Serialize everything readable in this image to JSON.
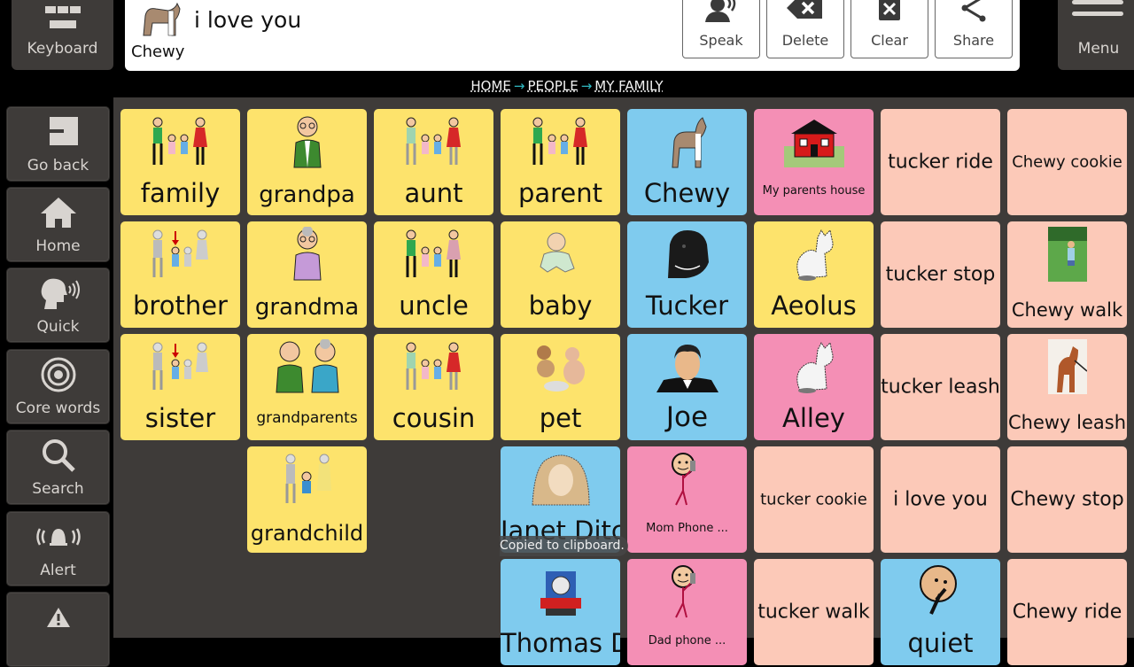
{
  "topbar": {
    "keyboard_label": "Keyboard",
    "menu_label": "Menu",
    "message": {
      "symbol_label": "Chewy",
      "text": "i love you"
    },
    "actions": [
      {
        "label": "Speak",
        "icon": "speak-icon"
      },
      {
        "label": "Delete",
        "icon": "backspace-icon"
      },
      {
        "label": "Clear",
        "icon": "clear-icon"
      },
      {
        "label": "Share",
        "icon": "share-icon"
      }
    ]
  },
  "breadcrumb": [
    "HOME",
    "PEOPLE",
    "MY FAMILY"
  ],
  "sidebar": {
    "items": [
      {
        "label": "Go back",
        "icon": "go-back-icon"
      },
      {
        "label": "Home",
        "icon": "home-icon"
      },
      {
        "label": "Quick",
        "icon": "quick-speak-icon"
      },
      {
        "label": "Core words",
        "icon": "core-words-icon"
      },
      {
        "label": "Search",
        "icon": "search-icon"
      },
      {
        "label": "Alert",
        "icon": "alert-bell-icon"
      },
      {
        "label": "",
        "icon": "warning-icon"
      }
    ]
  },
  "grid": {
    "tiles": [
      {
        "label": "family",
        "color": "yellow",
        "icon": "family-symbol"
      },
      {
        "label": "grandpa",
        "color": "yellow",
        "icon": "grandpa-symbol"
      },
      {
        "label": "aunt",
        "color": "yellow",
        "icon": "aunt-symbol"
      },
      {
        "label": "parent",
        "color": "yellow",
        "icon": "parent-symbol"
      },
      {
        "label": "Chewy",
        "color": "blue",
        "icon": "dog-chewy-symbol"
      },
      {
        "label": "My parents house",
        "color": "pink",
        "icon": "house-symbol"
      },
      {
        "label": "tucker ride",
        "color": "peach",
        "icon": ""
      },
      {
        "label": "Chewy cookie",
        "color": "peach",
        "icon": ""
      },
      {
        "label": "brother",
        "color": "yellow",
        "icon": "brother-symbol"
      },
      {
        "label": "grandma",
        "color": "yellow",
        "icon": "grandma-symbol"
      },
      {
        "label": "uncle",
        "color": "yellow",
        "icon": "uncle-symbol"
      },
      {
        "label": "baby",
        "color": "yellow",
        "icon": "baby-symbol"
      },
      {
        "label": "Tucker",
        "color": "blue",
        "icon": "dog-tucker-symbol"
      },
      {
        "label": "Aeolus",
        "color": "yellow",
        "icon": "cat-symbol"
      },
      {
        "label": "tucker stop",
        "color": "peach",
        "icon": ""
      },
      {
        "label": "Chewy walk",
        "color": "peach",
        "icon": "photo-walk-symbol"
      },
      {
        "label": "sister",
        "color": "yellow",
        "icon": "sister-symbol"
      },
      {
        "label": "grandparents",
        "color": "yellow",
        "icon": "grandparents-symbol"
      },
      {
        "label": "cousin",
        "color": "yellow",
        "icon": "cousin-symbol"
      },
      {
        "label": "pet",
        "color": "yellow",
        "icon": "pet-symbol"
      },
      {
        "label": "Joe",
        "color": "blue",
        "icon": "person-joe-symbol"
      },
      {
        "label": "Alley",
        "color": "pink",
        "icon": "cat-symbol"
      },
      {
        "label": "tucker leash",
        "color": "peach",
        "icon": ""
      },
      {
        "label": "Chewy leash",
        "color": "peach",
        "icon": "photo-leash-symbol"
      },
      {
        "label": "",
        "color": "",
        "icon": ""
      },
      {
        "label": "grandchild",
        "color": "yellow",
        "icon": "grandchild-symbol"
      },
      {
        "label": "",
        "color": "",
        "icon": ""
      },
      {
        "label": "Janet Ditch",
        "color": "blue",
        "icon": "person-janet-symbol"
      },
      {
        "label": "Mom Phone ...",
        "color": "pink",
        "icon": "phone-call-symbol"
      },
      {
        "label": "tucker cookie",
        "color": "peach",
        "icon": ""
      },
      {
        "label": "i love you",
        "color": "peach",
        "icon": ""
      },
      {
        "label": "Chewy stop",
        "color": "peach",
        "icon": ""
      },
      {
        "label": "",
        "color": "",
        "icon": ""
      },
      {
        "label": "",
        "color": "",
        "icon": ""
      },
      {
        "label": "",
        "color": "",
        "icon": ""
      },
      {
        "label": "Thomas Ditch",
        "color": "blue",
        "icon": "train-symbol"
      },
      {
        "label": "Dad phone ...",
        "color": "pink",
        "icon": "phone-call-symbol"
      },
      {
        "label": "tucker walk",
        "color": "peach",
        "icon": ""
      },
      {
        "label": "quiet",
        "color": "blue",
        "icon": "quiet-symbol"
      },
      {
        "label": "Chewy ride",
        "color": "peach",
        "icon": ""
      }
    ]
  },
  "toast": "Copied to clipboard."
}
